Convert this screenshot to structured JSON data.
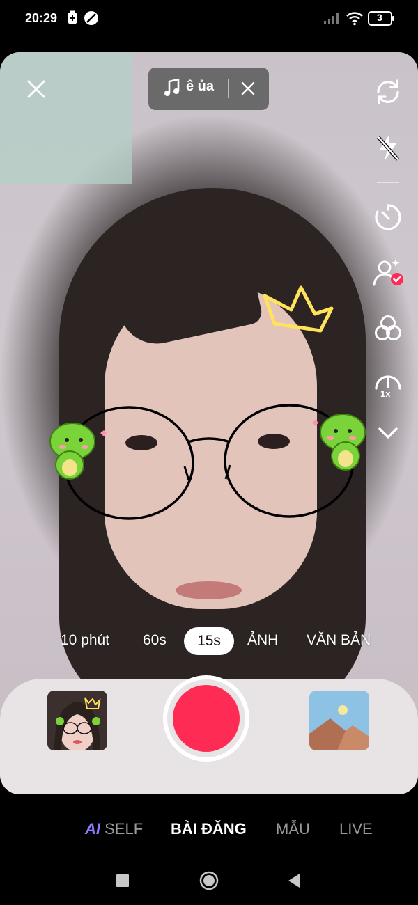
{
  "status_bar": {
    "time": "20:29",
    "battery_level": "3"
  },
  "music": {
    "title": "ê ủa"
  },
  "side_tools": {
    "speed_label": "1x"
  },
  "capture_modes": {
    "items": [
      {
        "label": "10 phút"
      },
      {
        "label": "60s"
      },
      {
        "label": "15s"
      },
      {
        "label": "ẢNH"
      },
      {
        "label": "VĂN BẢN"
      }
    ],
    "selected": "15s"
  },
  "bottom_tabs": {
    "ai_prefix": "AI",
    "ai_rest": "SELF",
    "post": "BÀI ĐĂNG",
    "template": "MẪU",
    "live": "LIVE"
  },
  "colors": {
    "record": "#fe2c55",
    "ai_accent": "#8a7cff",
    "crown_glow": "#ffe35a",
    "dino_green": "#7bd33a"
  }
}
